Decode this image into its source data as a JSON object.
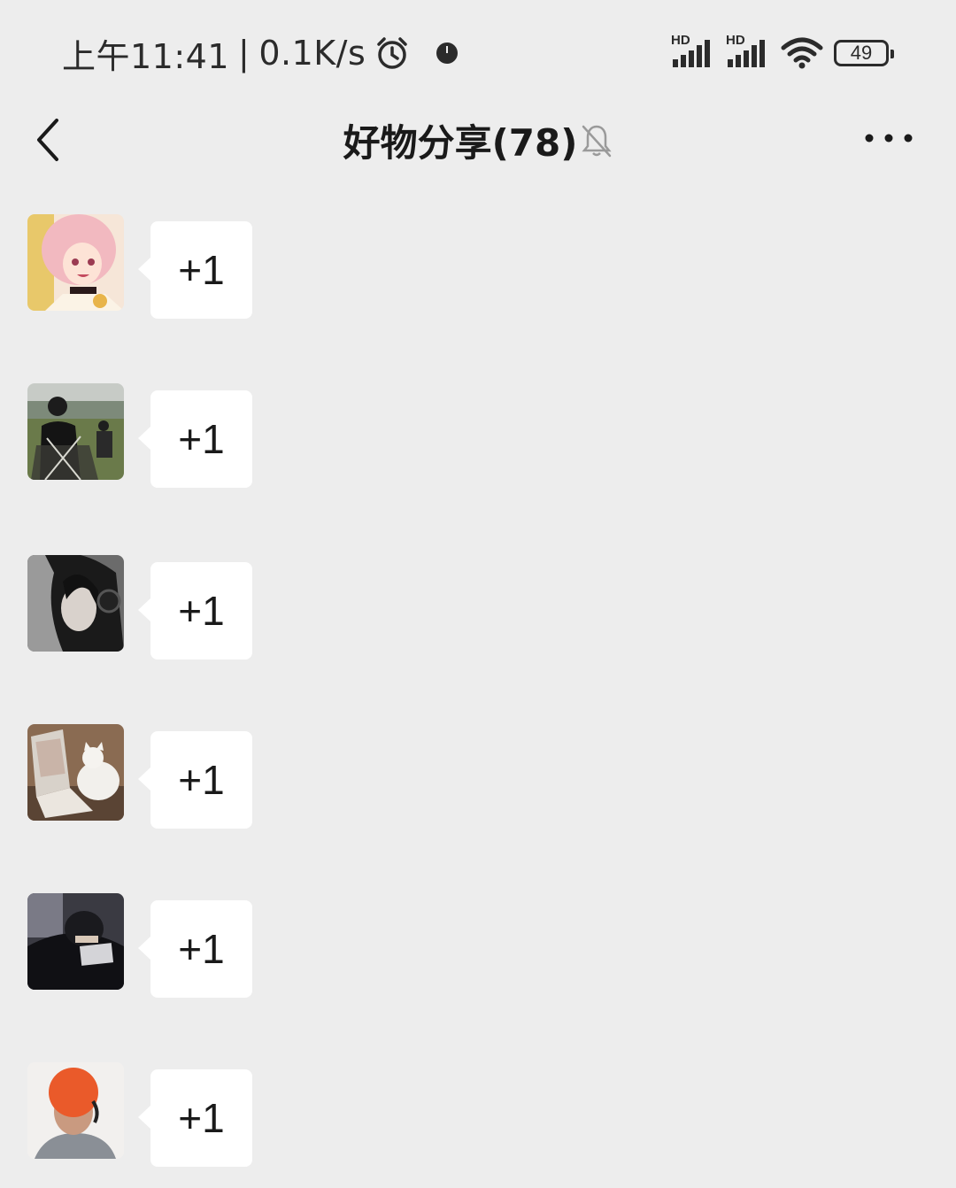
{
  "status_bar": {
    "time": "上午11:41",
    "separator": "|",
    "net_speed": "0.1K/s",
    "sim1_label": "HD",
    "sim2_label": "HD",
    "battery": "49"
  },
  "header": {
    "title": "好物分享(78)"
  },
  "messages": [
    {
      "text": "+1",
      "avatar": "anime-girl-avatar"
    },
    {
      "text": "+1",
      "avatar": "outdoor-person-avatar"
    },
    {
      "text": "+1",
      "avatar": "headphone-person-avatar"
    },
    {
      "text": "+1",
      "avatar": "cat-laptop-avatar"
    },
    {
      "text": "+1",
      "avatar": "dark-person-avatar"
    },
    {
      "text": "+1",
      "avatar": "orange-hair-avatar"
    }
  ],
  "colors": {
    "background": "#ededed",
    "bubble": "#ffffff",
    "text": "#1a1a1a"
  }
}
